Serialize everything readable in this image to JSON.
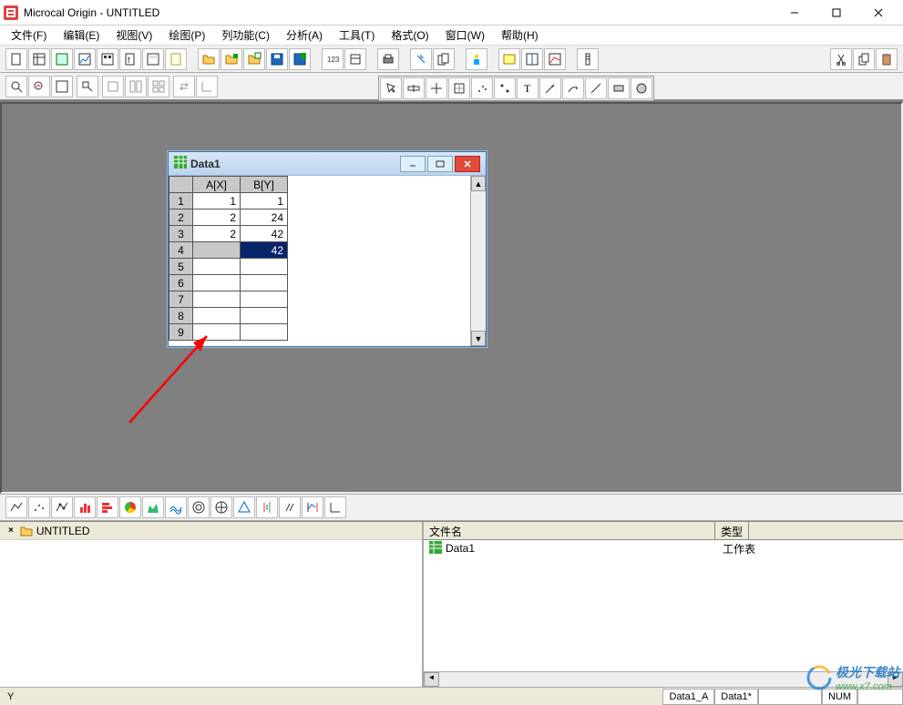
{
  "title": "Microcal Origin - UNTITLED",
  "menu": {
    "file": "文件(F)",
    "edit": "编辑(E)",
    "view": "视图(V)",
    "plot": "绘图(P)",
    "column": "列功能(C)",
    "analysis": "分析(A)",
    "tools": "工具(T)",
    "format": "格式(O)",
    "window": "窗口(W)",
    "help": "帮助(H)"
  },
  "data_window": {
    "title": "Data1",
    "columns": {
      "a": "A[X]",
      "b": "B[Y]"
    },
    "rows": [
      {
        "idx": "1",
        "a": "1",
        "b": "1"
      },
      {
        "idx": "2",
        "a": "2",
        "b": "24"
      },
      {
        "idx": "3",
        "a": "2",
        "b": "42"
      },
      {
        "idx": "4",
        "a": "",
        "b": "42",
        "editing": true
      },
      {
        "idx": "5",
        "a": "",
        "b": ""
      },
      {
        "idx": "6",
        "a": "",
        "b": ""
      },
      {
        "idx": "7",
        "a": "",
        "b": ""
      },
      {
        "idx": "8",
        "a": "",
        "b": ""
      },
      {
        "idx": "9",
        "a": "",
        "b": ""
      }
    ]
  },
  "project_tree": {
    "root": "UNTITLED"
  },
  "file_list": {
    "col_name": "文件名",
    "col_type": "类型",
    "items": [
      {
        "name": "Data1",
        "type": "工作表"
      }
    ]
  },
  "status": {
    "left": "Y",
    "s1": "Data1_A",
    "s2": "Data1*",
    "s3": "NUM"
  },
  "watermark": {
    "text1": "极光下载站",
    "text2": "www.x7.com"
  },
  "pin_handle": "×"
}
